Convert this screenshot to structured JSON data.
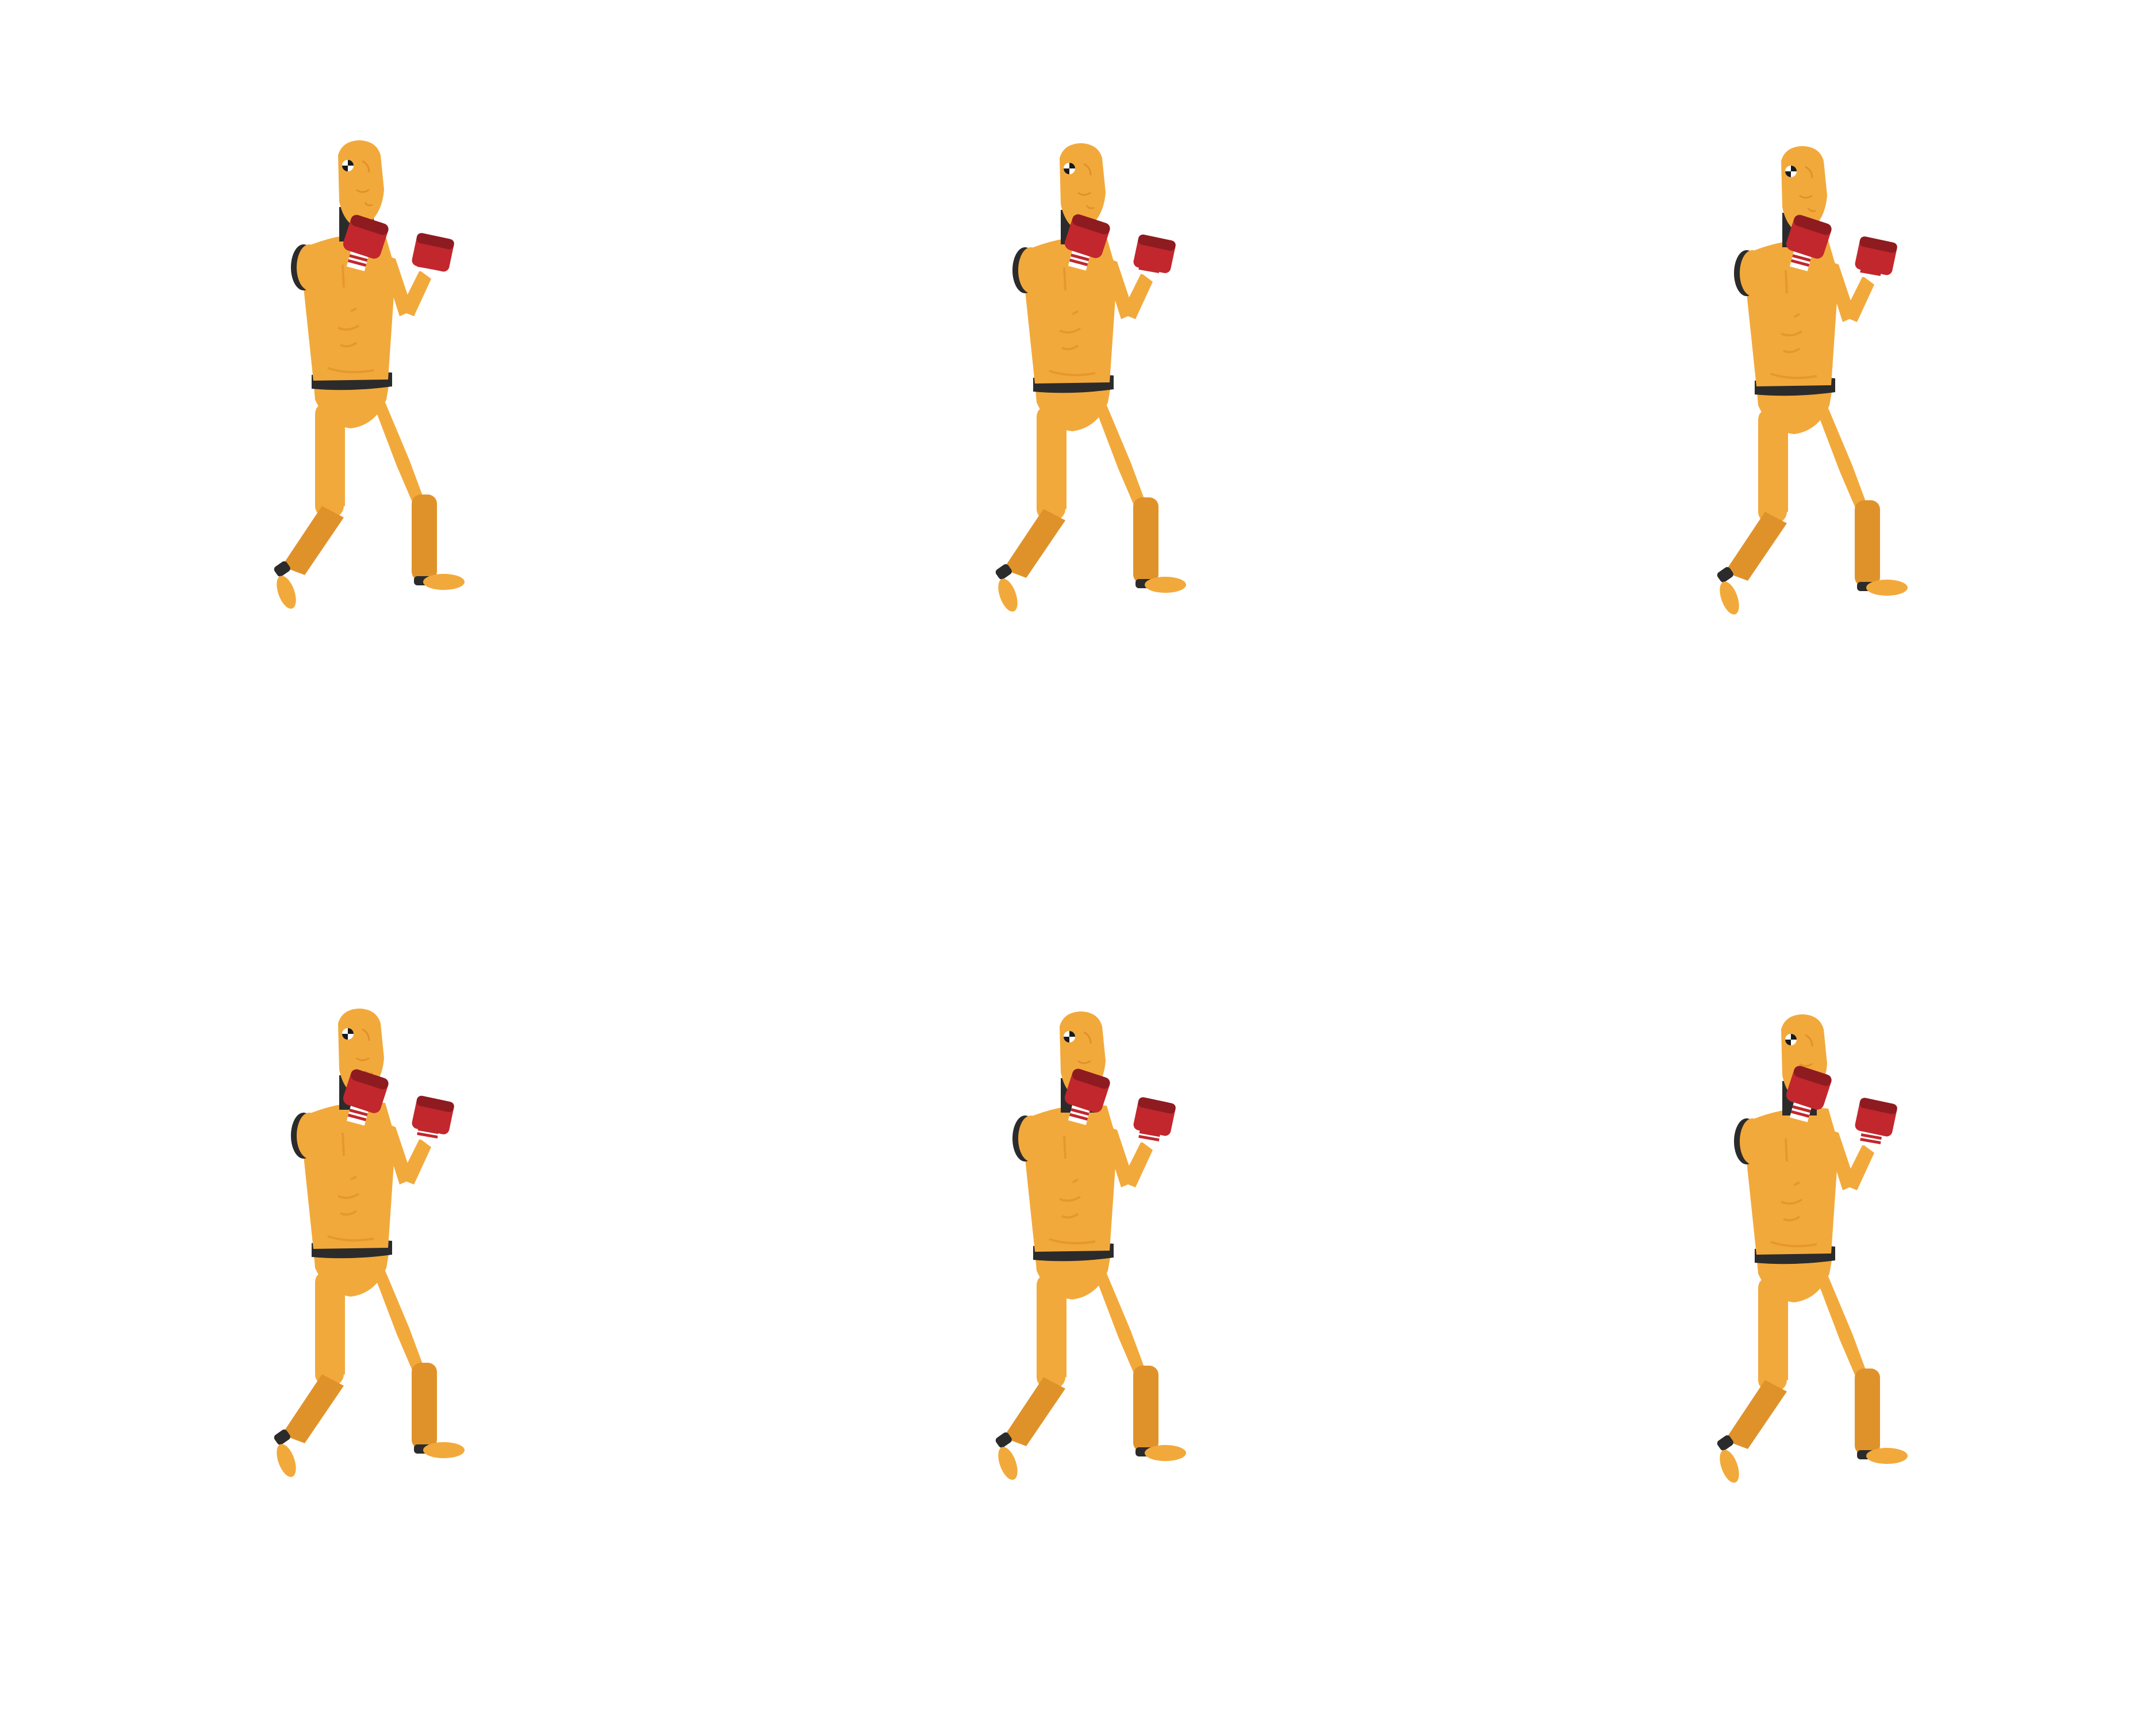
{
  "sprite_sheet": {
    "background_color": "#ffffff",
    "character": "crash-test-dummy-boxer",
    "colors": {
      "body": "#f2a93b",
      "body_shade": "#e0922a",
      "joints": "#2b2b2b",
      "gloves": "#c1272d",
      "gloves_dark": "#8e1b20",
      "wrist_tape": "#ffffff",
      "crash_marker": "#1a1a1a"
    },
    "frames": [
      {
        "id": "frame-1",
        "pose": "guard-stance",
        "lead_glove_raise": 0
      },
      {
        "id": "frame-2",
        "pose": "guard-stance",
        "lead_glove_raise": 6
      },
      {
        "id": "frame-3",
        "pose": "guard-stance",
        "lead_glove_raise": 10
      },
      {
        "id": "frame-4",
        "pose": "guard-stance",
        "lead_glove_raise": 24
      },
      {
        "id": "frame-5",
        "pose": "guard-stance",
        "lead_glove_raise": 30
      },
      {
        "id": "frame-6",
        "pose": "guard-stance",
        "lead_glove_raise": 40
      }
    ]
  }
}
